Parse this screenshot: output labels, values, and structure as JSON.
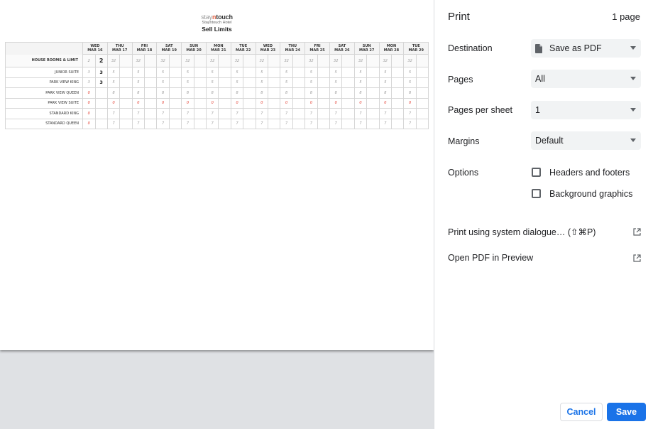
{
  "preview": {
    "logo": {
      "part1": "stay",
      "part2": "n",
      "part3": "touch"
    },
    "hotel_name": "Stayntouch Hotel",
    "report_title": "Sell Limits",
    "house_label": "HOUSE ROOMS & LIMIT",
    "days": [
      {
        "dow": "WED",
        "date": "MAR 16"
      },
      {
        "dow": "THU",
        "date": "MAR 17"
      },
      {
        "dow": "FRI",
        "date": "MAR 18"
      },
      {
        "dow": "SAT",
        "date": "MAR 19"
      },
      {
        "dow": "SUN",
        "date": "MAR 20"
      },
      {
        "dow": "MON",
        "date": "MAR 21"
      },
      {
        "dow": "TUE",
        "date": "MAR 22"
      },
      {
        "dow": "WED",
        "date": "MAR 23"
      },
      {
        "dow": "THU",
        "date": "MAR 24"
      },
      {
        "dow": "FRI",
        "date": "MAR 25"
      },
      {
        "dow": "SAT",
        "date": "MAR 26"
      },
      {
        "dow": "SUN",
        "date": "MAR 27"
      },
      {
        "dow": "MON",
        "date": "MAR 28"
      },
      {
        "dow": "TUE",
        "date": "MAR 29"
      }
    ],
    "house_row": {
      "first_value": "2",
      "first_entry": "2",
      "value": "32"
    },
    "room_rows": [
      {
        "label": "JUNIOR SUITE",
        "first": "3",
        "entry": "3",
        "value": "5",
        "red": false
      },
      {
        "label": "PARK VIEW KING",
        "first": "3",
        "entry": "3",
        "value": "5",
        "red": false
      },
      {
        "label": "PARK VIEW QUEEN",
        "first": "0",
        "entry": "",
        "value": "8",
        "red": false
      },
      {
        "label": "PARK VIEW SUITE",
        "first": "0",
        "entry": "",
        "value": "0",
        "red": true
      },
      {
        "label": "STANDARD KING",
        "first": "0",
        "entry": "",
        "value": "7",
        "red": false
      },
      {
        "label": "STANDARD QUEEN",
        "first": "0",
        "entry": "",
        "value": "7",
        "red": false
      }
    ]
  },
  "panel": {
    "title": "Print",
    "page_count": "1 page",
    "destination": {
      "label": "Destination",
      "value": "Save as PDF"
    },
    "pages": {
      "label": "Pages",
      "value": "All"
    },
    "pages_per_sheet": {
      "label": "Pages per sheet",
      "value": "1"
    },
    "margins": {
      "label": "Margins",
      "value": "Default"
    },
    "options": {
      "label": "Options",
      "headers_footers": "Headers and footers",
      "background_graphics": "Background graphics"
    },
    "system_dialog": "Print using system dialogue… (⇧⌘P)",
    "open_pdf": "Open PDF in Preview",
    "cancel": "Cancel",
    "save": "Save"
  },
  "colors": {
    "accent": "#1a73e8",
    "error_red": "#e23b2e",
    "panel_field_bg": "#f1f3f4"
  },
  "icons": {
    "pdf": "document-icon",
    "caret": "caret-down-icon",
    "external": "open-in-new-icon"
  }
}
